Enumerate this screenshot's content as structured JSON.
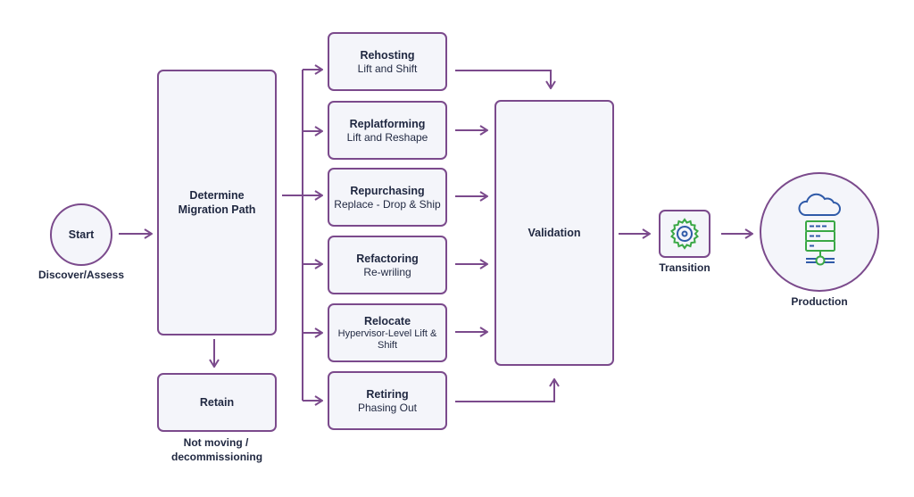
{
  "colors": {
    "stroke": "#7b4a8c",
    "fill": "#f4f5fa",
    "text": "#1f2740",
    "icon_green": "#3aa845",
    "icon_blue": "#2f5aa8"
  },
  "start": {
    "title": "Start",
    "caption": "Discover/Assess"
  },
  "determine": {
    "title": "Determine Migration Path"
  },
  "retain": {
    "title": "Retain",
    "caption": "Not moving / decommissioning"
  },
  "strategies": [
    {
      "title": "Rehosting",
      "subtitle": "Lift and Shift"
    },
    {
      "title": "Replatforming",
      "subtitle": "Lift and Reshape"
    },
    {
      "title": "Repurchasing",
      "subtitle": "Replace - Drop & Ship"
    },
    {
      "title": "Refactoring",
      "subtitle": "Re-wriling"
    },
    {
      "title": "Relocate",
      "subtitle": "Hypervisor-Level Lift & Shift"
    },
    {
      "title": "Retiring",
      "subtitle": "Phasing Out"
    }
  ],
  "validation": {
    "title": "Validation"
  },
  "transition": {
    "caption": "Transition",
    "icon": "gear-icon"
  },
  "production": {
    "caption": "Production",
    "icons": [
      "cloud-icon",
      "server-icon"
    ]
  }
}
